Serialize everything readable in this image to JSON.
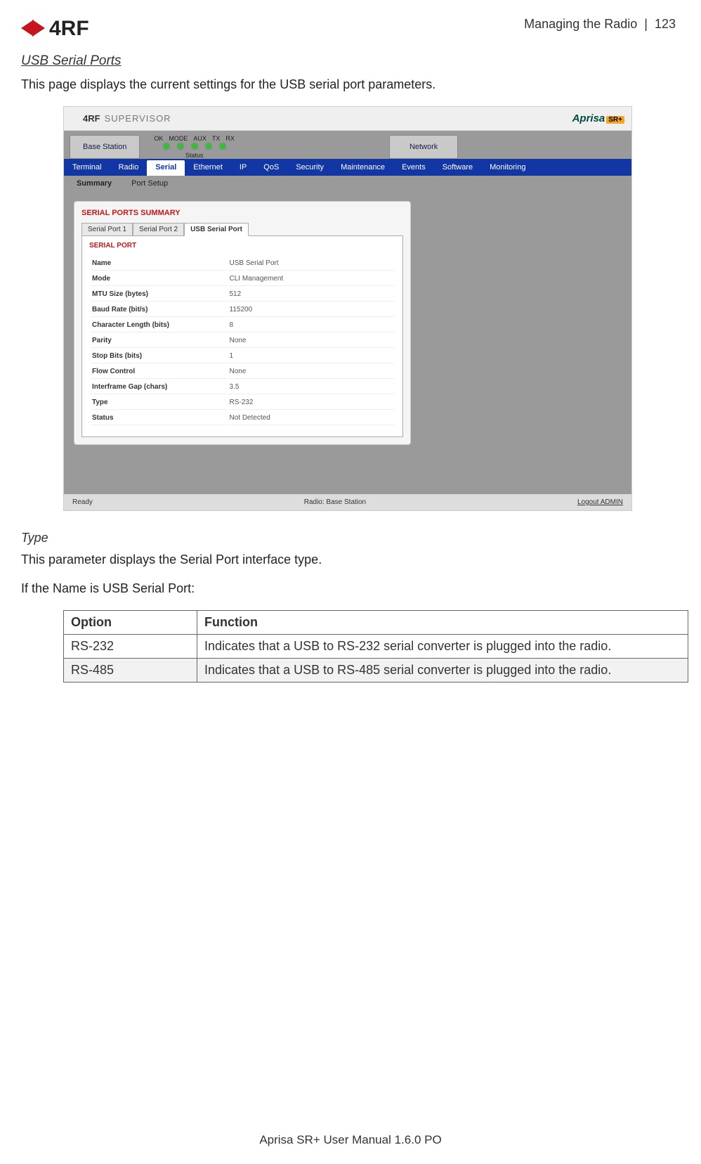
{
  "header": {
    "logo_text": "4RF",
    "section": "Managing the Radio",
    "page_num": "123"
  },
  "titles": {
    "usb_serial_ports": "USB Serial Ports",
    "intro": "This page displays the current settings for the USB serial port parameters.",
    "type_heading": "Type",
    "type_desc": "This parameter displays the Serial Port interface type.",
    "if_name": "If the Name is USB Serial Port:"
  },
  "screenshot": {
    "supervisor": "SUPERVISOR",
    "logo": "4RF",
    "brand": "Aprisa",
    "brand_suffix": "SR+",
    "base_station": "Base Station",
    "network": "Network",
    "led_labels": [
      "OK",
      "MODE",
      "AUX",
      "TX",
      "RX"
    ],
    "status_label": "Status",
    "nav": [
      "Terminal",
      "Radio",
      "Serial",
      "Ethernet",
      "IP",
      "QoS",
      "Security",
      "Maintenance",
      "Events",
      "Software",
      "Monitoring"
    ],
    "active_nav": "Serial",
    "subnav": [
      "Summary",
      "Port Setup"
    ],
    "active_subnav": "Summary",
    "panel_title": "SERIAL PORTS SUMMARY",
    "port_tabs": [
      "Serial Port 1",
      "Serial Port 2",
      "USB Serial Port"
    ],
    "active_port_tab": "USB Serial Port",
    "inner_title": "SERIAL PORT",
    "rows": [
      {
        "k": "Name",
        "v": "USB Serial Port"
      },
      {
        "k": "Mode",
        "v": "CLI Management"
      },
      {
        "k": "MTU Size (bytes)",
        "v": "512"
      },
      {
        "k": "Baud Rate (bit/s)",
        "v": "115200"
      },
      {
        "k": "Character Length (bits)",
        "v": "8"
      },
      {
        "k": "Parity",
        "v": "None"
      },
      {
        "k": "Stop Bits (bits)",
        "v": "1"
      },
      {
        "k": "Flow Control",
        "v": "None"
      },
      {
        "k": "Interframe Gap (chars)",
        "v": "3.5"
      },
      {
        "k": "Type",
        "v": "RS-232"
      },
      {
        "k": "Status",
        "v": "Not Detected"
      }
    ],
    "footer": {
      "ready": "Ready",
      "radio": "Radio: Base Station",
      "logout": "Logout ADMIN"
    }
  },
  "options_table": {
    "header": {
      "option": "Option",
      "function": "Function"
    },
    "rows": [
      {
        "option": "RS-232",
        "function": "Indicates that a USB to RS-232 serial converter is plugged into the radio."
      },
      {
        "option": "RS-485",
        "function": "Indicates that a USB to RS-485 serial converter is plugged into the radio."
      }
    ]
  },
  "footer_text": "Aprisa SR+ User Manual 1.6.0 PO"
}
